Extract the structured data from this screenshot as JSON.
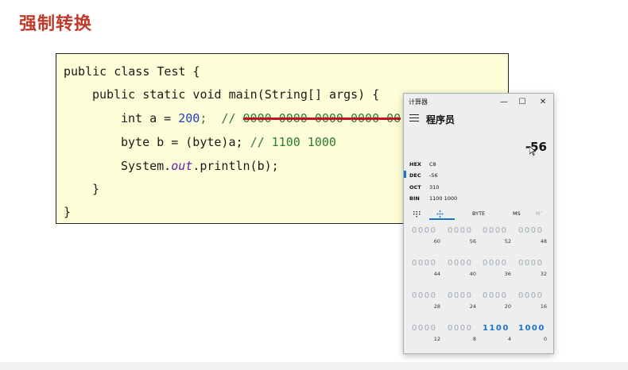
{
  "slide": {
    "title": "强制转换"
  },
  "code": {
    "line1": "public class Test {",
    "line2": "public static void main(String[] args) {",
    "line3_pre": "int a = ",
    "line3_num": "200",
    "line3_mid": ";  // ",
    "line3_strike": "0000 0000 0000 0000 00",
    "line4_pre": "byte b = (byte)a; ",
    "line4_cmt": "// 1100 1000",
    "line5_pre": "System.",
    "line5_field": "out",
    "line5_post": ".println(b);",
    "line6": "}",
    "line7": "}"
  },
  "calculator": {
    "title": "计算器",
    "min": "—",
    "max": "☐",
    "close": "✕",
    "mode": "程序员",
    "display": "-56",
    "radix": [
      {
        "label": "HEX",
        "value": "C8"
      },
      {
        "label": "DEC",
        "value": "-56"
      },
      {
        "label": "OCT",
        "value": "310"
      },
      {
        "label": "BIN",
        "value": "1100 1000"
      }
    ],
    "tabs": {
      "word": "BYTE",
      "ms": "MS",
      "mplus": "M˅"
    },
    "bit_rows": [
      {
        "nibbles": [
          "0000",
          "0000",
          "0000",
          "0000"
        ],
        "positions": [
          "60",
          "56",
          "52",
          "48"
        ]
      },
      {
        "nibbles": [
          "0000",
          "0000",
          "0000",
          "0000"
        ],
        "positions": [
          "44",
          "40",
          "36",
          "32"
        ]
      },
      {
        "nibbles": [
          "0000",
          "0000",
          "0000",
          "0000"
        ],
        "positions": [
          "28",
          "24",
          "20",
          "16"
        ]
      },
      {
        "nibbles": [
          "0000",
          "0000",
          "1100",
          "1000"
        ],
        "positions": [
          "12",
          "8",
          "4",
          "0"
        ]
      }
    ]
  }
}
